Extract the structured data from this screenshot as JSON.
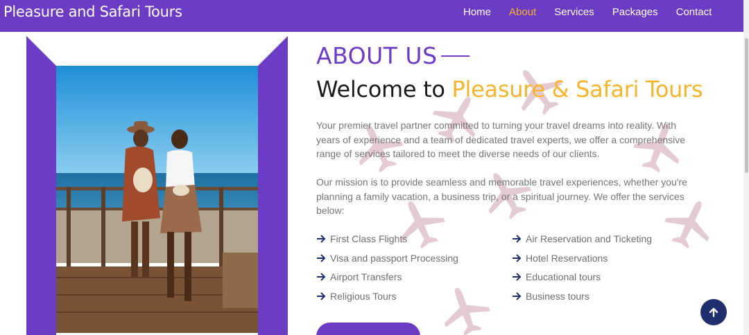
{
  "nav": {
    "brand": "Pleasure and Safari Tours",
    "links": [
      {
        "label": "Home",
        "active": false
      },
      {
        "label": "About",
        "active": true
      },
      {
        "label": "Services",
        "active": false
      },
      {
        "label": "Packages",
        "active": false
      },
      {
        "label": "Contact",
        "active": false
      }
    ]
  },
  "about": {
    "label": "ABOUT US",
    "heading_prefix": "Welcome to ",
    "heading_accent": "Pleasure & Safari Tours",
    "para1": "Your premier travel partner committed to turning your travel dreams into reality. With years of experience and a team of dedicated travel experts, we offer a comprehensive range of services tailored to meet the diverse needs of our clients.",
    "para2": "Our mission is to provide seamless and memorable travel experiences, whether you're planning a family vacation, a business trip, or a spiritual journey. We offer the services below:",
    "services_left": [
      "First Class Flights",
      "Visa and passport Processing",
      "Airport Transfers",
      "Religious Tours"
    ],
    "services_right": [
      "Air Reservation and Ticketing",
      "Hotel Reservations",
      "Educational tours",
      "Business tours"
    ]
  },
  "colors": {
    "brand": "#6c3cc4",
    "accent": "#f6b42a",
    "back_to_top": "#1f2f6e"
  },
  "icons": {
    "service_bullet": "arrow-right-icon",
    "back_to_top": "arrow-up-icon",
    "background": "airplane-icon"
  }
}
